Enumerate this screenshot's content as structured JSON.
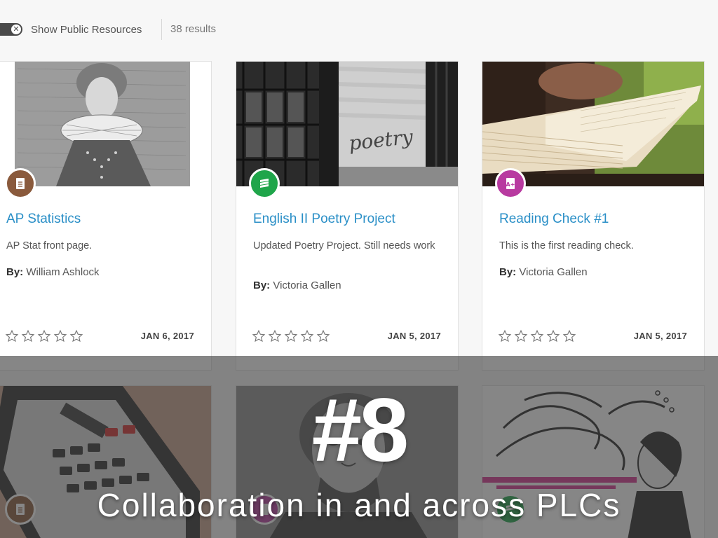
{
  "filter": {
    "toggle_label": "Show Public Resources",
    "toggle_icon": "x-icon",
    "results": "38 results"
  },
  "cards": [
    {
      "title": "AP Statistics",
      "description": "AP Stat front page.",
      "author_label": "By:",
      "author": "William Ashlock",
      "date": "JAN 6, 2017",
      "badge_icon": "document-icon",
      "badge_color": "#8a5a3c"
    },
    {
      "title": "English II Poetry Project",
      "description": "Updated Poetry Project. Still needs work",
      "author_label": "By:",
      "author": "Victoria Gallen",
      "date": "JAN 5, 2017",
      "badge_icon": "layers-icon",
      "badge_color": "#1fa54a"
    },
    {
      "title": "Reading Check #1",
      "description": "This is the first reading check.",
      "author_label": "By:",
      "author": "Victoria Gallen",
      "date": "JAN 5, 2017",
      "badge_icon": "assessment-icon",
      "badge_color": "#b83aa0"
    }
  ],
  "overlay": {
    "number": "#8",
    "subtitle": "Collaboration in and across PLCs"
  },
  "poetry_text": "poetry"
}
